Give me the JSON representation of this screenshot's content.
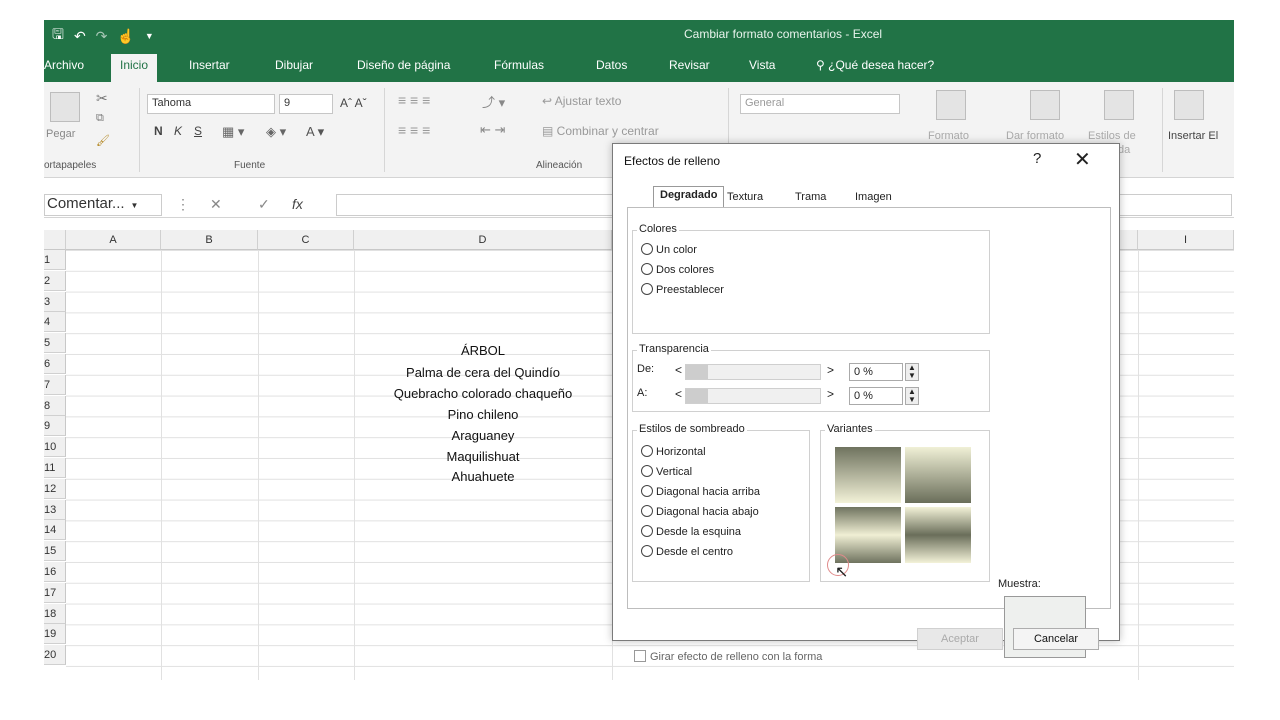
{
  "window": {
    "title": "Cambiar formato comentarios - Excel"
  },
  "tabs": [
    "Archivo",
    "Inicio",
    "Insertar",
    "Dibujar",
    "Diseño de página",
    "Fórmulas",
    "Datos",
    "Revisar",
    "Vista"
  ],
  "tell_me": "¿Qué desea hacer?",
  "ribbon": {
    "paste": "Pegar",
    "clipboard": "ortapapeles",
    "font_name": "Tahoma",
    "font_size": "9",
    "bold": "N",
    "italic": "K",
    "underline": "S",
    "font_group": "Fuente",
    "wrap_text": "Ajustar texto",
    "merge": "Combinar y centrar",
    "alignment_group": "Alineación",
    "number_format": "General",
    "cond_format": "Formato",
    "format_table": "Dar formato",
    "cell_styles": "Estilos de",
    "cell_styles_sub": "celda",
    "insert": "Insertar",
    "insert_suffix": "El"
  },
  "formula_bar": {
    "name_box": "Comentar...",
    "fx": "fx"
  },
  "columns": [
    "A",
    "B",
    "C",
    "D",
    "I"
  ],
  "rows": [
    "1",
    "2",
    "3",
    "4",
    "5",
    "6",
    "7",
    "8",
    "9",
    "10",
    "11",
    "12",
    "13",
    "14",
    "15",
    "16",
    "17",
    "18",
    "19",
    "20"
  ],
  "cells": {
    "d5": "ÁRBOL",
    "d6": "Palma de cera del Quindío",
    "d7": "Quebracho colorado chaqueño",
    "d8": "Pino chileno",
    "d9": "Araguaney",
    "d10": "Maquilishuat",
    "d11": "Ahuahuete"
  },
  "dialog": {
    "title": "Efectos de relleno",
    "help": "?",
    "close": "✕",
    "tabs": [
      "Degradado",
      "Textura",
      "Trama",
      "Imagen"
    ],
    "colors_legend": "Colores",
    "colors_options": [
      "Un color",
      "Dos colores",
      "Preestablecer"
    ],
    "transparency_legend": "Transparencia",
    "from_label": "De:",
    "to_label": "A:",
    "from_value": "0 %",
    "to_value": "0 %",
    "shading_legend": "Estilos de sombreado",
    "shading_options": [
      "Horizontal",
      "Vertical",
      "Diagonal hacia arriba",
      "Diagonal hacia abajo",
      "Desde la esquina",
      "Desde el centro"
    ],
    "variants_legend": "Variantes",
    "sample_label": "Muestra:",
    "rotate_check": "Girar efecto de relleno con la forma",
    "ok": "Aceptar",
    "cancel": "Cancelar"
  }
}
